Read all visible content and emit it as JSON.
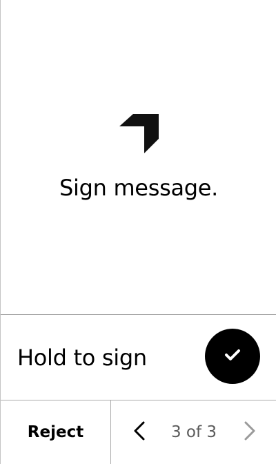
{
  "hero": {
    "icon": "corner-arrow-icon",
    "title": "Sign message."
  },
  "hold": {
    "label": "Hold to sign",
    "button_icon": "checkmark-icon"
  },
  "footer": {
    "reject_label": "Reject",
    "prev_icon": "chevron-left-icon",
    "next_icon": "chevron-right-icon",
    "page_indicator": "3 of 3"
  },
  "colors": {
    "background": "#ffffff",
    "foreground": "#000000",
    "divider": "#a9a9a9",
    "muted_text": "#5a5a5a",
    "disabled_icon": "#9a9a9a"
  }
}
